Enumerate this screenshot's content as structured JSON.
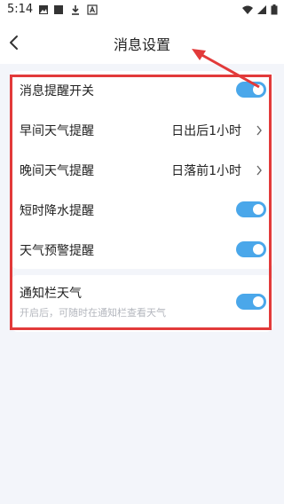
{
  "status_bar": {
    "time": "5:14",
    "icons": [
      "image-icon",
      "square-icon",
      "download-icon",
      "letter-a-icon"
    ],
    "right_icons": [
      "wifi-icon",
      "signal-icon",
      "battery-icon"
    ]
  },
  "header": {
    "title": "消息设置",
    "back_icon": "chevron-left-icon"
  },
  "settings": {
    "items": [
      {
        "label": "消息提醒开关",
        "type": "toggle",
        "on": true
      },
      {
        "label": "早间天气提醒",
        "type": "link",
        "value": "日出后1小时"
      },
      {
        "label": "晚间天气提醒",
        "type": "link",
        "value": "日落前1小时"
      },
      {
        "label": "短时降水提醒",
        "type": "toggle",
        "on": true
      },
      {
        "label": "天气预警提醒",
        "type": "toggle",
        "on": true
      }
    ],
    "notify_bar": {
      "label": "通知栏天气",
      "description": "开启后，可随时在通知栏查看天气",
      "on": true
    }
  },
  "colors": {
    "accent": "#4aa7ea",
    "annotation": "#e23a3a",
    "background": "#f3f5fa"
  }
}
